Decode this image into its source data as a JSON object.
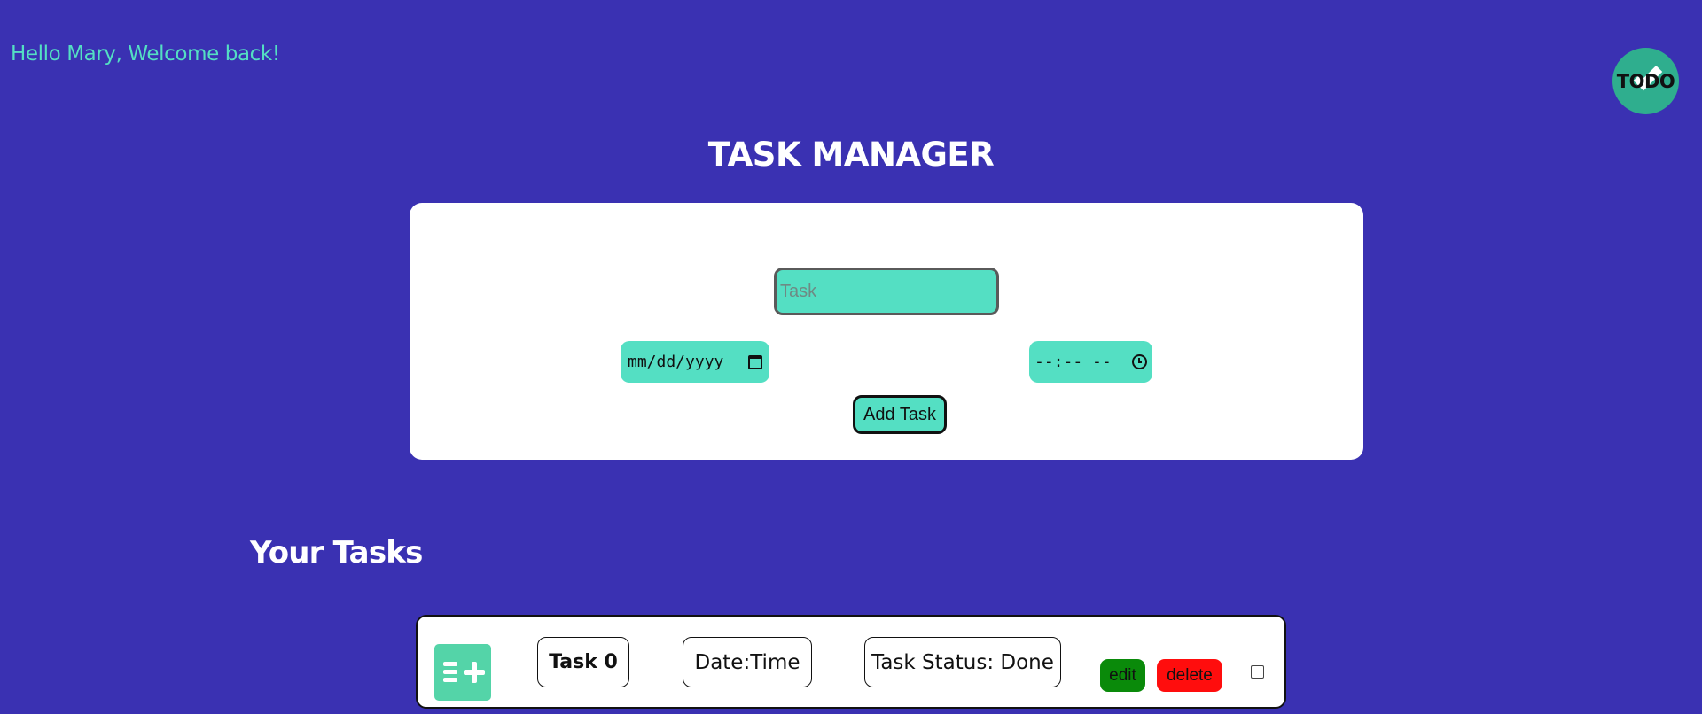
{
  "header": {
    "greeting": "Hello Mary, Welcome back!",
    "logo_text": "TODO"
  },
  "page_title": "TASK MANAGER",
  "form": {
    "task_placeholder": "Task",
    "date_placeholder": "mm/dd/yyyy",
    "time_placeholder": "--:-- --",
    "add_button_label": "Add Task"
  },
  "tasks_section": {
    "heading": "Your Tasks",
    "tasks": [
      {
        "name": "Task 0",
        "datetime": "Date:Time",
        "status": "Task Status: Done",
        "edit_label": "edit",
        "delete_label": "delete",
        "checked": false
      }
    ]
  },
  "colors": {
    "background": "#3a31b2",
    "accent": "#54dfc3",
    "logo": "#2fae8e",
    "edit": "#0a8a0a",
    "delete": "#ff0d0d"
  }
}
